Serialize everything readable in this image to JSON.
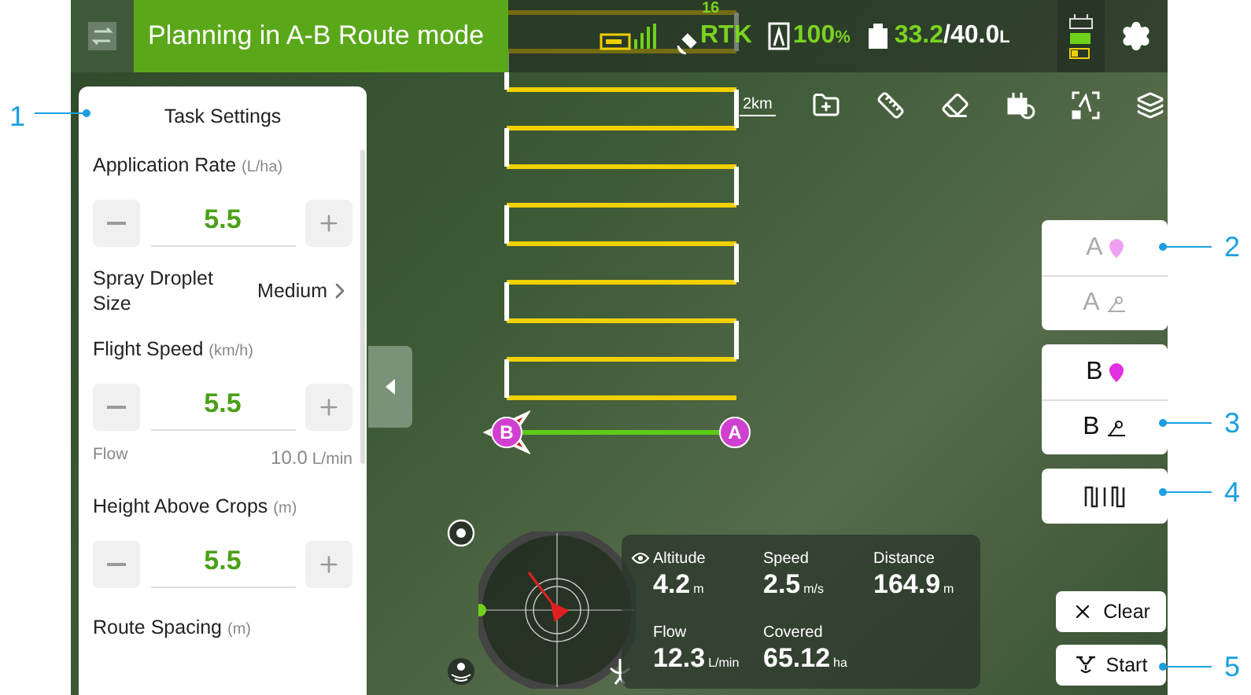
{
  "top_bar": {
    "title": "Planning in A-B Route mode",
    "rtk_count": "16",
    "rtk_label": "RTK",
    "battery": "100",
    "battery_unit": "%",
    "tank_current": "33.2",
    "tank_total": "/40.0",
    "tank_unit": "L"
  },
  "map_toolbar": {
    "scale": "2km"
  },
  "task_settings": {
    "title": "Task Settings",
    "items": [
      {
        "kind": "stepper",
        "label": "Application Rate",
        "unit": "(L/ha)",
        "value": "5.5"
      },
      {
        "kind": "select",
        "label": "Spray Droplet Size",
        "value": "Medium"
      },
      {
        "kind": "stepper",
        "label": "Flight Speed",
        "unit": "(km/h)",
        "value": "5.5"
      },
      {
        "kind": "info",
        "label": "Flow",
        "value": "10.0",
        "unit": "L/min"
      },
      {
        "kind": "stepper",
        "label": "Height Above Crops",
        "unit": "(m)",
        "value": "5.5"
      },
      {
        "kind": "heading",
        "label": "Route Spacing",
        "unit": "(m)"
      }
    ]
  },
  "route_markers": [
    "B",
    "A"
  ],
  "telemetry": [
    {
      "label": "Altitude",
      "value": "4.2",
      "unit": "m"
    },
    {
      "label": "Speed",
      "value": "2.5",
      "unit": "m/s"
    },
    {
      "label": "Distance",
      "value": "164.9",
      "unit": "m"
    },
    {
      "label": "Flow",
      "value": "12.3",
      "unit": "L/min"
    },
    {
      "label": "Covered",
      "value": "65.12",
      "unit": "ha"
    }
  ],
  "point_buttons": [
    {
      "disabled": true,
      "rows": [
        {
          "kind": "pin",
          "letter": "A"
        },
        {
          "kind": "aim",
          "letter": "A"
        }
      ]
    },
    {
      "disabled": false,
      "rows": [
        {
          "kind": "pin",
          "letter": "B"
        },
        {
          "kind": "aim",
          "letter": "B"
        }
      ]
    }
  ],
  "actions": [
    {
      "kind": "clear",
      "label": "Clear"
    },
    {
      "kind": "start",
      "label": "Start"
    }
  ],
  "callouts": [
    "1",
    "2",
    "3",
    "4",
    "5"
  ]
}
